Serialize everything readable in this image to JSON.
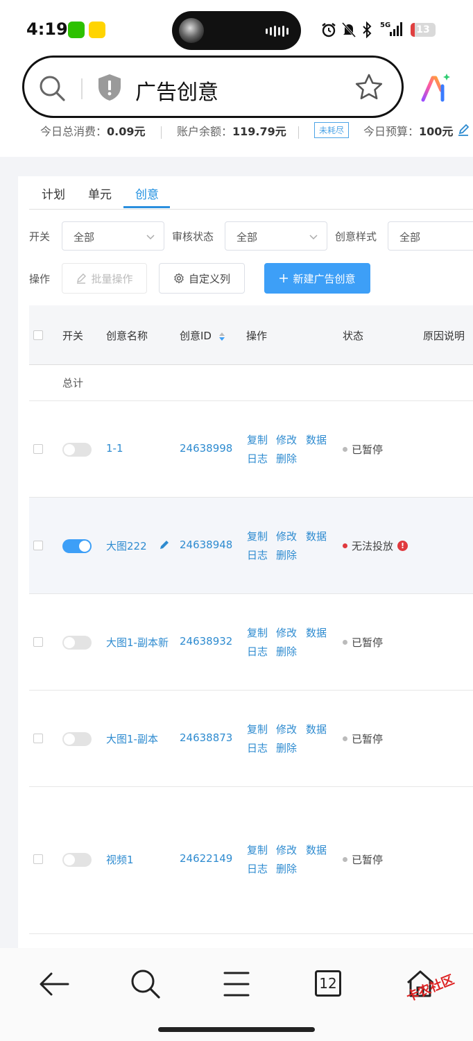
{
  "status_bar": {
    "time": "4:19",
    "battery": "13",
    "network": "5G"
  },
  "address_bar": {
    "title": "广告创意"
  },
  "summary": {
    "total_spend_label": "今日总消费：",
    "total_spend_value": "0.09元",
    "balance_label": "账户余额：",
    "balance_value": "119.79元",
    "budget_tag": "未耗尽",
    "budget_label": "今日预算：",
    "budget_value": "100元"
  },
  "tabs": [
    {
      "label": "计划"
    },
    {
      "label": "单元"
    },
    {
      "label": "创意",
      "active": true
    }
  ],
  "filters": {
    "switch_label": "开关",
    "switch_value": "全部",
    "review_label": "审核状态",
    "review_value": "全部",
    "style_label": "创意样式",
    "style_value": "全部",
    "action_label": "操作",
    "batch_button": "批量操作",
    "columns_button": "自定义列",
    "new_button": "新建广告创意"
  },
  "table": {
    "headers": {
      "switch": "开关",
      "name": "创意名称",
      "id": "创意ID",
      "actions": "操作",
      "status": "状态",
      "reason": "原因说明"
    },
    "total_label": "总计",
    "action_labels": {
      "copy": "复制",
      "edit": "修改",
      "data": "数据",
      "log": "日志",
      "delete": "删除"
    },
    "rows": [
      {
        "name": "1-1",
        "id": "24638998",
        "on": false,
        "status": "已暂停"
      },
      {
        "name": "大图222",
        "id": "24638948",
        "on": true,
        "status": "无法投放"
      },
      {
        "name": "大图1-副本新",
        "id": "24638932",
        "on": false,
        "status": "已暂停"
      },
      {
        "name": "大图1-副本",
        "id": "24638873",
        "on": false,
        "status": "已暂停"
      },
      {
        "name": "视频1",
        "id": "24622149",
        "on": false,
        "status": "已暂停"
      }
    ]
  },
  "bottom_nav": {
    "tabs_count": "12"
  },
  "watermark": "卡农社区",
  "colors": {
    "accent": "#3d9ff7",
    "link": "#2e8bd0",
    "error": "#e0393e"
  }
}
